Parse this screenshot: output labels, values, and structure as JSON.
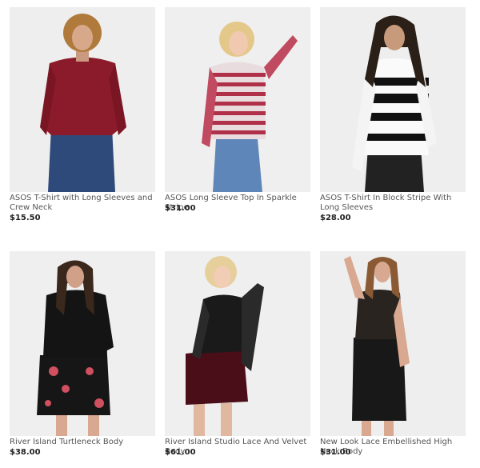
{
  "products": [
    {
      "title": "ASOS T-Shirt with Long Sleeves and Crew Neck",
      "price": "$15.50",
      "image": "woman-red-long-sleeve-tee"
    },
    {
      "title": "ASOS Long Sleeve Top In Sparkle Stripe",
      "price": "$31.00",
      "image": "woman-striped-long-sleeve-top"
    },
    {
      "title": "ASOS T-Shirt In Block Stripe With Long Sleeves",
      "price": "$28.00",
      "image": "woman-block-stripe-tee"
    },
    {
      "title": "River Island Turtleneck Body",
      "price": "$38.00",
      "image": "woman-black-turtleneck-floral-skirt"
    },
    {
      "title": "River Island Studio Lace And Velvet Body",
      "price": "$61.00",
      "image": "woman-lace-velvet-body"
    },
    {
      "title": "New Look Lace Embellished High Neck Body",
      "price": "$31.00",
      "image": "woman-lace-body-leather-skirt"
    }
  ]
}
